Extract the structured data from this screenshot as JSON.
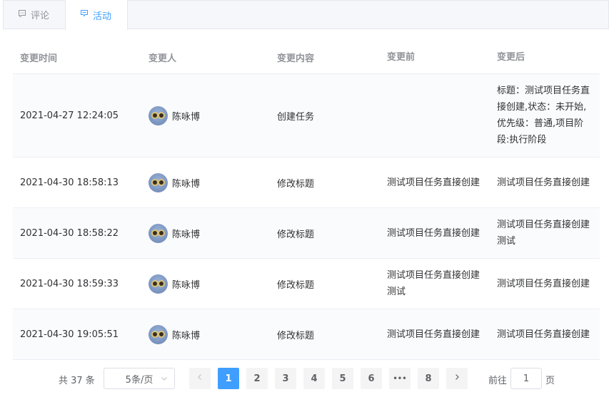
{
  "tabs": [
    {
      "label": "评论",
      "icon": "comment-icon",
      "active": false
    },
    {
      "label": "活动",
      "icon": "activity-icon",
      "active": true
    }
  ],
  "table": {
    "headers": [
      "变更时间",
      "变更人",
      "变更内容",
      "变更前",
      "变更后"
    ],
    "rows": [
      {
        "time": "2021-04-27 12:24:05",
        "user": "陈咏博",
        "content": "创建任务",
        "before": "",
        "after": "标题：测试项目任务直接创建,状态：未开始,优先级：普通,项目阶段:执行阶段"
      },
      {
        "time": "2021-04-30 18:58:13",
        "user": "陈咏博",
        "content": "修改标题",
        "before": "测试项目任务直接创建",
        "after": "测试项目任务直接创建"
      },
      {
        "time": "2021-04-30 18:58:22",
        "user": "陈咏博",
        "content": "修改标题",
        "before": "测试项目任务直接创建",
        "after": "测试项目任务直接创建测试"
      },
      {
        "time": "2021-04-30 18:59:33",
        "user": "陈咏博",
        "content": "修改标题",
        "before": "测试项目任务直接创建测试",
        "after": "测试项目任务直接创建"
      },
      {
        "time": "2021-04-30 19:05:51",
        "user": "陈咏博",
        "content": "修改标题",
        "before": "测试项目任务直接创建",
        "after": "测试项目任务直接创建"
      }
    ]
  },
  "pagination": {
    "total": "共 37 条",
    "page_size": "5条/页",
    "pages": [
      "1",
      "2",
      "3",
      "4",
      "5",
      "6",
      "•••",
      "8"
    ],
    "current": "1",
    "goto_label": "前往",
    "goto_value": "1",
    "page_suffix": "页"
  },
  "colors": {
    "accent": "#409eff",
    "header_text": "#909399",
    "border": "#ebeef5"
  }
}
